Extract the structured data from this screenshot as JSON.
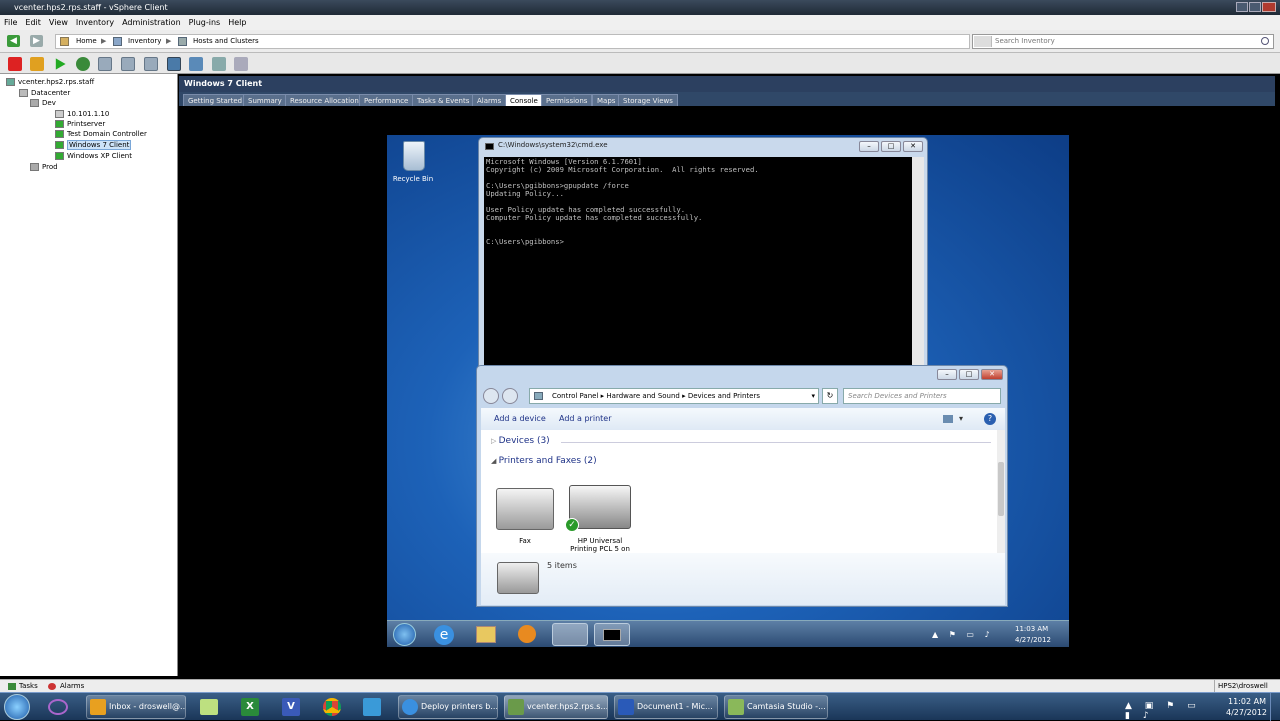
{
  "window": {
    "title": "vcenter.hps2.rps.staff - vSphere Client"
  },
  "menu": [
    "File",
    "Edit",
    "View",
    "Inventory",
    "Administration",
    "Plug-ins",
    "Help"
  ],
  "nav": {
    "breadcrumbs": [
      "Home",
      "Inventory",
      "Hosts and Clusters"
    ],
    "search_placeholder": "Search Inventory"
  },
  "tree": {
    "root": "vcenter.hps2.rps.staff",
    "datacenter": "Datacenter",
    "folder_dev": "Dev",
    "host": "10.101.1.10",
    "vms": [
      "Printserver",
      "Test Domain Controller",
      "Windows 7 Client",
      "Windows XP Client"
    ],
    "folder_prod": "Prod"
  },
  "vm": {
    "title": "Windows 7 Client",
    "tabs": [
      "Getting Started",
      "Summary",
      "Resource Allocation",
      "Performance",
      "Tasks & Events",
      "Alarms",
      "Console",
      "Permissions",
      "Maps",
      "Storage Views"
    ],
    "active_tab": "Console"
  },
  "guest": {
    "desktop_icon": "Recycle Bin",
    "cmd": {
      "title": "C:\\Windows\\system32\\cmd.exe",
      "output": "Microsoft Windows [Version 6.1.7601]\nCopyright (c) 2009 Microsoft Corporation.  All rights reserved.\n\nC:\\Users\\pgibbons>gpupdate /force\nUpdating Policy...\n\nUser Policy update has completed successfully.\nComputer Policy update has completed successfully.\n\n\nC:\\Users\\pgibbons>"
    },
    "control_panel": {
      "breadcrumbs": [
        "Control Panel",
        "Hardware and Sound",
        "Devices and Printers"
      ],
      "search_placeholder": "Search Devices and Printers",
      "commands": [
        "Add a device",
        "Add a printer"
      ],
      "groups": [
        "Devices (3)",
        "Printers and Faxes (2)"
      ],
      "printers": [
        "Fax",
        "HP Universal Printing PCL 5 on"
      ],
      "item_count": "5 items"
    },
    "clock": {
      "time": "11:03 AM",
      "date": "4/27/2012"
    }
  },
  "statusbar": {
    "tasks": "Tasks",
    "alarms": "Alarms",
    "user": "HPS2\\droswell"
  },
  "host_taskbar": {
    "items": [
      "Inbox - droswell@...",
      "Deploy printers b...",
      "vcenter.hps2.rps.s...",
      "Document1 - Mic...",
      "Camtasia Studio -..."
    ],
    "time": "11:02 AM",
    "date": "4/27/2012"
  }
}
